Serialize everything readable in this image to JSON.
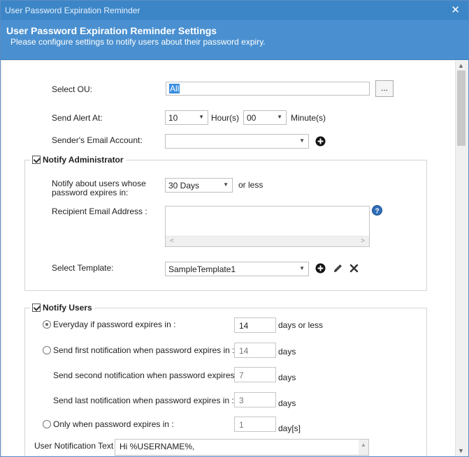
{
  "window": {
    "title": "User Password Expiration Reminder",
    "close_glyph": "✕"
  },
  "header": {
    "title": "User Password Expiration Reminder Settings",
    "subtitle": "Please configure settings to notify users about their password expiry."
  },
  "general": {
    "ou_label": "Select OU:",
    "ou_value": "All",
    "ou_browse_label": "...",
    "alert_label": "Send Alert At:",
    "hour_value": "10",
    "hour_unit": "Hour(s)",
    "minute_value": "00",
    "minute_unit": "Minute(s)",
    "sender_label": "Sender's Email Account:",
    "sender_value": ""
  },
  "notify_admin": {
    "title": "Notify Administrator",
    "checked": true,
    "expires_label_line1": "Notify about users whose",
    "expires_label_line2": "password expires in:",
    "expires_value": "30 Days",
    "expires_suffix": "or less",
    "recipient_label": "Recipient Email Address :",
    "template_label": "Select Template:",
    "template_value": "SampleTemplate1"
  },
  "notify_users": {
    "title": "Notify Users",
    "checked": true,
    "opt_everyday_label": "Everyday if password expires in :",
    "opt_everyday_value": "14",
    "opt_everyday_suffix": "days or less",
    "opt_first_label": "Send first notification when password expires in :",
    "opt_first_value": "14",
    "opt_first_suffix": "days",
    "opt_second_label": "Send second notification when password expires in :",
    "opt_second_value": "7",
    "opt_second_suffix": "days",
    "opt_last_label": "Send last notification when password expires in :",
    "opt_last_value": "3",
    "opt_last_suffix": "days",
    "opt_only_label": "Only when password expires in :",
    "opt_only_value": "1",
    "opt_only_suffix": "day[s]",
    "selected_option": "everyday",
    "text_label": "User Notification Text :",
    "text_value": "Hi %USERNAME%,"
  },
  "icons": {
    "add": "add-icon",
    "help": "help-icon",
    "edit": "pencil-icon",
    "delete": "delete-icon"
  },
  "colors": {
    "titlebar": "#3c86c8",
    "header": "#4a90d0",
    "selection": "#3a8de0"
  }
}
